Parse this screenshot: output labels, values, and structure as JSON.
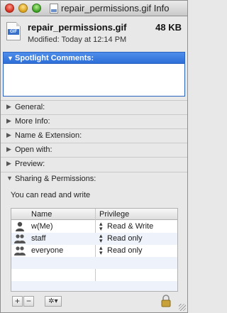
{
  "window": {
    "title": "repair_permissions.gif Info"
  },
  "header": {
    "file_name": "repair_permissions.gif",
    "file_size": "48 KB",
    "modified": "Modified: Today at 12:14 PM",
    "icon_tag": "GIF"
  },
  "spotlight": {
    "label": "Spotlight Comments:",
    "comment": ""
  },
  "sections": [
    {
      "label": "General:"
    },
    {
      "label": "More Info:"
    },
    {
      "label": "Name & Extension:"
    },
    {
      "label": "Open with:"
    },
    {
      "label": "Preview:"
    },
    {
      "label": "Sharing & Permissions:"
    }
  ],
  "permissions": {
    "note": "You can read and write",
    "columns": {
      "name": "Name",
      "privilege": "Privilege"
    },
    "rows": [
      {
        "name": "w(Me)",
        "privilege": "Read & Write",
        "icon": "single-user-icon"
      },
      {
        "name": "staff",
        "privilege": "Read only",
        "icon": "group-icon"
      },
      {
        "name": "everyone",
        "privilege": "Read only",
        "icon": "group-icon"
      }
    ]
  },
  "toolbar": {
    "add": "+",
    "remove": "−",
    "action": "✲▾"
  },
  "colors": {
    "accent": "#2d6fd8",
    "selection_stripe": "#eef3fb"
  }
}
